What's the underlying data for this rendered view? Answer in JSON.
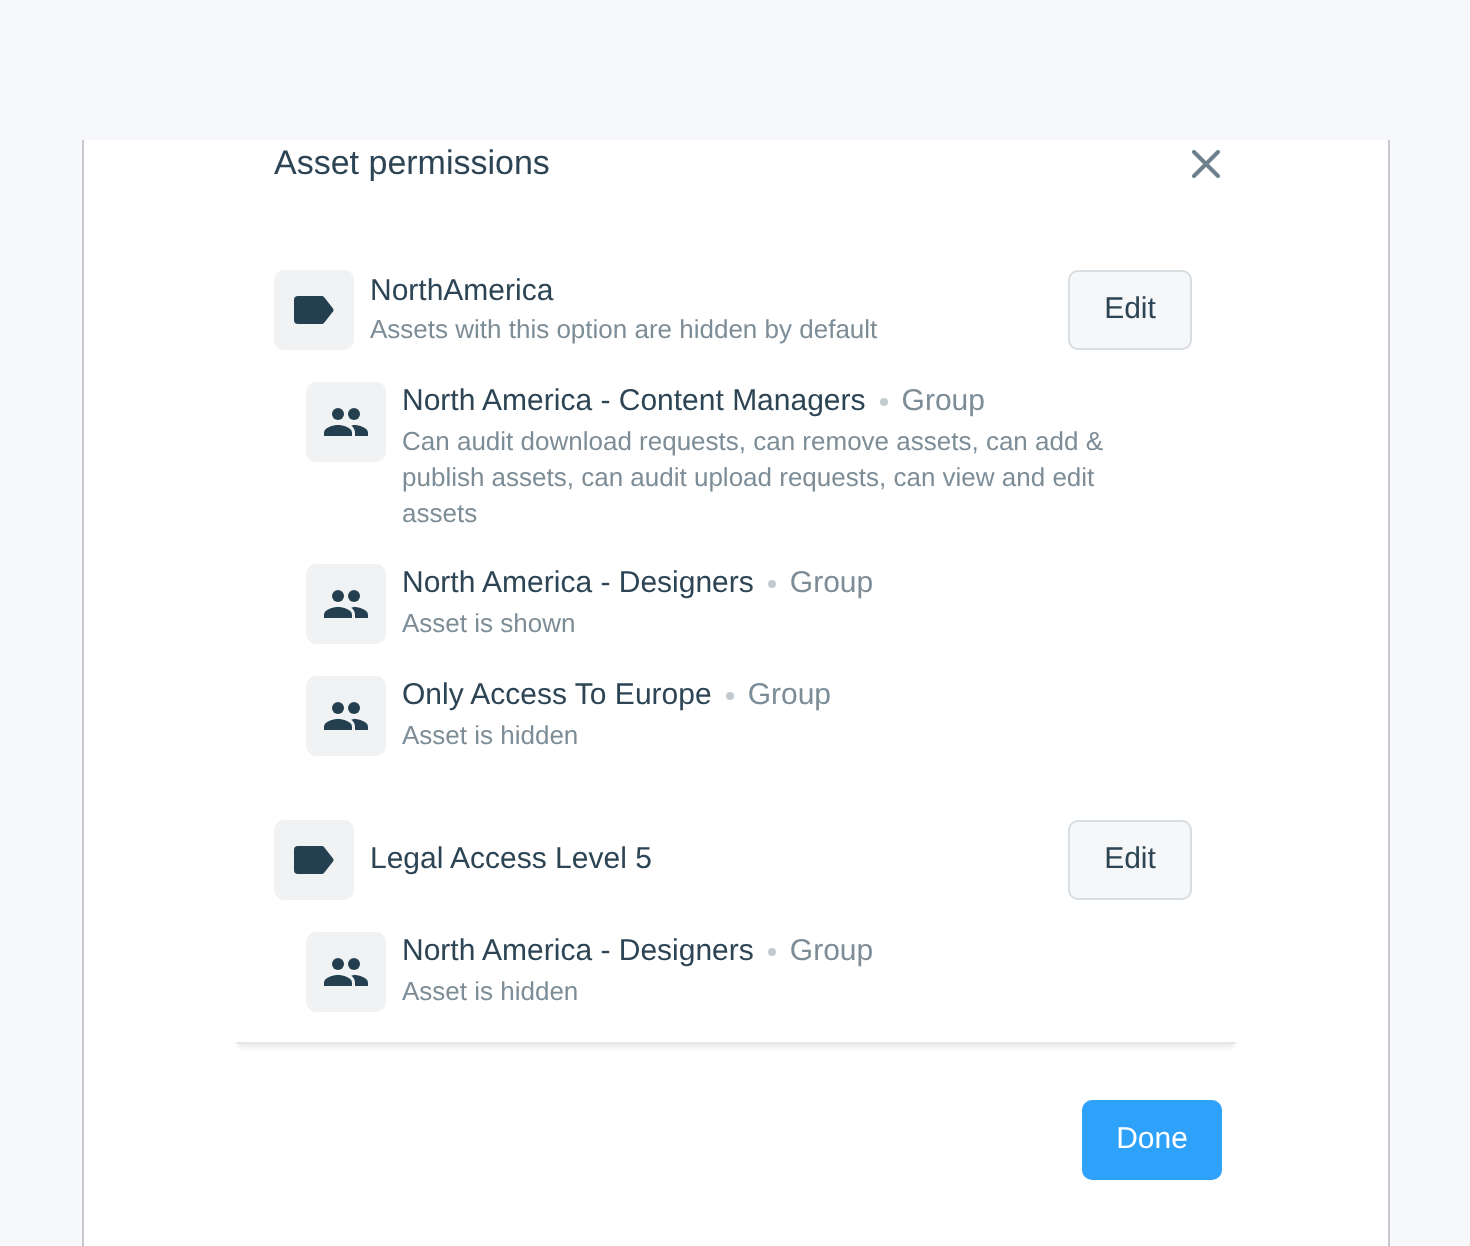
{
  "dialog": {
    "title": "Asset permissions",
    "options": [
      {
        "name": "NorthAmerica",
        "description": "Assets with this option are hidden by default",
        "edit_button": "Edit",
        "groups": [
          {
            "name": "North America - Content Managers",
            "type": "Group",
            "description": "Can audit download requests, can remove assets, can add & publish assets, can audit upload requests, can view and edit assets"
          },
          {
            "name": "North America - Designers",
            "type": "Group",
            "description": "Asset is shown"
          },
          {
            "name": "Only Access To Europe",
            "type": "Group",
            "description": "Asset is hidden"
          }
        ]
      },
      {
        "name": "Legal Access Level 5",
        "edit_button": "Edit",
        "groups": [
          {
            "name": "North America - Designers",
            "type": "Group",
            "description": "Asset is hidden"
          }
        ]
      }
    ],
    "done_button": "Done"
  }
}
